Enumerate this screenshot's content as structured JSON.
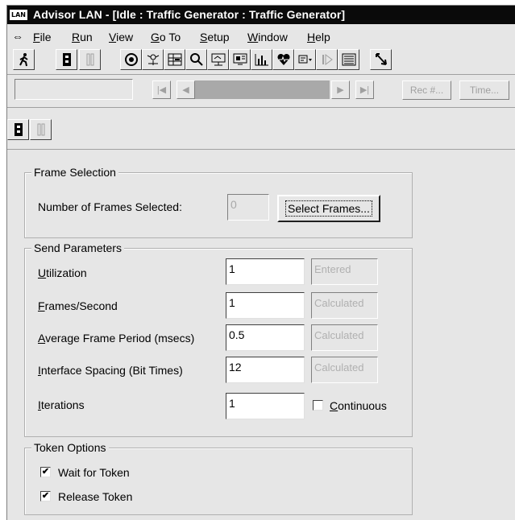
{
  "window": {
    "title": "Advisor LAN - [Idle : Traffic Generator : Traffic Generator]",
    "app_icon_text": "LAN"
  },
  "menu": {
    "items": [
      {
        "label": "File",
        "ul": "F",
        "rest": "ile"
      },
      {
        "label": "Run",
        "ul": "R",
        "rest": "un"
      },
      {
        "label": "View",
        "ul": "V",
        "rest": "iew"
      },
      {
        "label": "Go To",
        "ul": "G",
        "rest": "o To"
      },
      {
        "label": "Setup",
        "ul": "S",
        "rest": "etup"
      },
      {
        "label": "Window",
        "ul": "W",
        "rest": "indow"
      },
      {
        "label": "Help",
        "ul": "H",
        "rest": "elp"
      }
    ]
  },
  "toolbar": {
    "icons": [
      "run-person-icon",
      "start-icon",
      "pause-icon",
      "monitor-icon",
      "filter-icon",
      "statistics-icon",
      "search-icon",
      "capture-icon",
      "decode-icon",
      "bar-chart-icon",
      "heart-icon",
      "dropdown-icon",
      "play-icon",
      "list-icon",
      "pointer-icon"
    ]
  },
  "playback": {
    "rec_label": "Rec #...",
    "time_label": "Time..."
  },
  "frame_selection": {
    "legend": "Frame Selection",
    "count_label": "Number of Frames Selected:",
    "count_value": "0",
    "select_button": "Select Frames..."
  },
  "send_parameters": {
    "legend": "Send Parameters",
    "rows": [
      {
        "ul": "U",
        "rest": "tilization",
        "value": "1",
        "status": "Entered"
      },
      {
        "ul": "F",
        "rest": "rames/Second",
        "value": "1",
        "status": "Calculated"
      },
      {
        "ul": "A",
        "rest": "verage Frame Period (msecs)",
        "value": "0.5",
        "status": "Calculated"
      },
      {
        "ul": "I",
        "rest": "nterface Spacing (Bit Times)",
        "value": "12",
        "status": "Calculated"
      },
      {
        "ul": "I",
        "rest": "terations",
        "value": "1"
      }
    ],
    "continuous_ul": "C",
    "continuous_rest": "ontinuous",
    "continuous_checked": false
  },
  "token_options": {
    "legend": "Token Options",
    "wait_label": "Wait for Token",
    "wait_checked": true,
    "release_label": "Release Token",
    "release_checked": true
  },
  "glyphs": {
    "check": "✔",
    "nav_first": "|◀",
    "nav_prev": "◀",
    "nav_next": "▶",
    "nav_last": "▶|",
    "menu_sys": "⇔"
  }
}
